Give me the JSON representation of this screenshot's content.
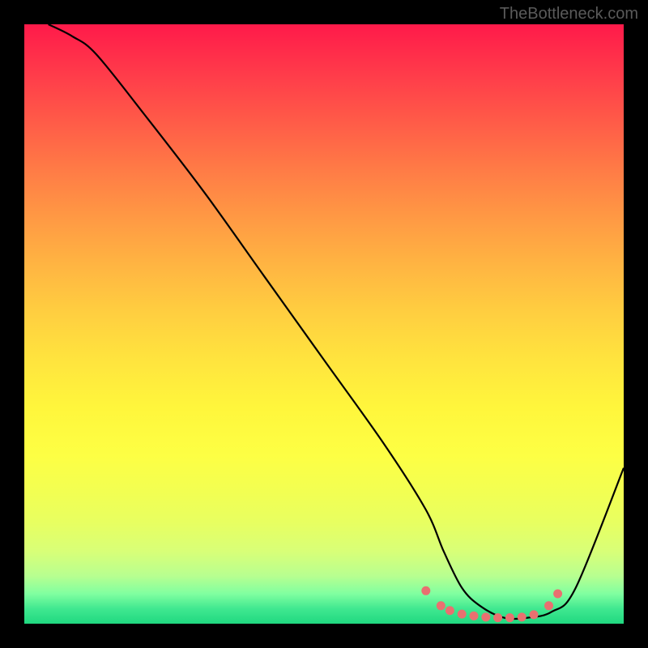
{
  "watermark": "TheBottleneck.com",
  "chart_data": {
    "type": "line",
    "title": "",
    "xlabel": "",
    "ylabel": "",
    "xlim": [
      0,
      100
    ],
    "ylim": [
      0,
      100
    ],
    "series": [
      {
        "name": "curve",
        "x": [
          4,
          8,
          12,
          20,
          30,
          40,
          50,
          60,
          67,
          70,
          73,
          76,
          80,
          84,
          88,
          92,
          100
        ],
        "values": [
          100,
          98,
          95,
          85,
          72,
          58,
          44,
          30,
          19,
          12,
          6,
          3,
          1,
          1,
          2,
          6,
          26
        ],
        "color": "#000000"
      },
      {
        "name": "bottom-dots",
        "x": [
          67,
          69.5,
          71,
          73,
          75,
          77,
          79,
          81,
          83,
          85,
          87.5,
          89
        ],
        "values": [
          5.5,
          3.0,
          2.2,
          1.6,
          1.3,
          1.1,
          1.0,
          1.0,
          1.1,
          1.5,
          3.0,
          5.0
        ],
        "color": "#e97070"
      }
    ],
    "gradient_stops": [
      {
        "pos": 0,
        "color": "#ff1a4a"
      },
      {
        "pos": 50,
        "color": "#ffd840"
      },
      {
        "pos": 80,
        "color": "#fcff48"
      },
      {
        "pos": 100,
        "color": "#20d880"
      }
    ]
  }
}
